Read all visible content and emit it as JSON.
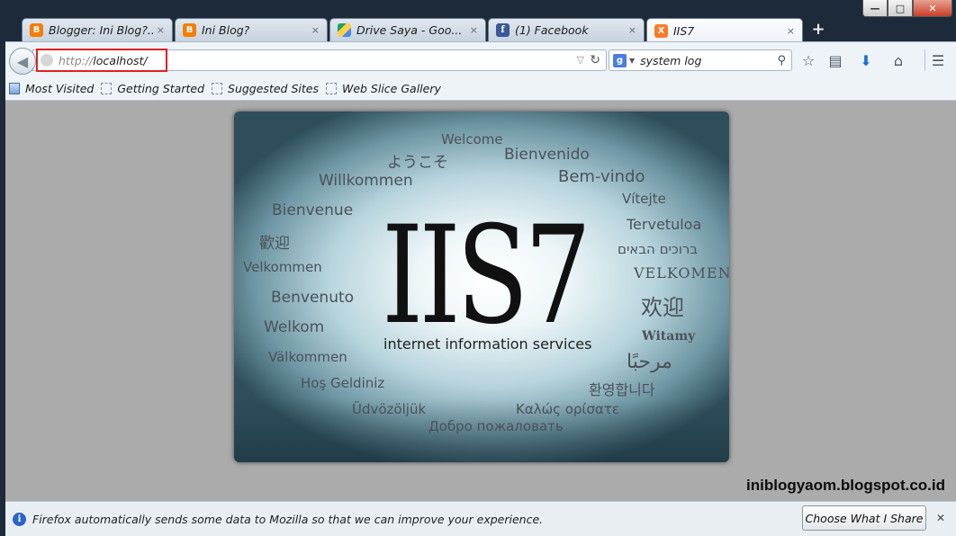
{
  "window_controls": {
    "minimize": "—",
    "maximize": "□",
    "close": "✕"
  },
  "tabs": [
    {
      "label": "Blogger: Ini Blog?...",
      "icon": "blogger-icon",
      "favicon_char": "B"
    },
    {
      "label": "Ini Blog?",
      "icon": "blogger-icon",
      "favicon_char": "B"
    },
    {
      "label": "Drive Saya - Goo...",
      "icon": "drive-icon",
      "favicon_char": ""
    },
    {
      "label": "(1) Facebook",
      "icon": "facebook-icon",
      "favicon_char": "f"
    },
    {
      "label": "IIS7",
      "icon": "xampp-icon",
      "favicon_char": "X",
      "active": true
    }
  ],
  "tab_close_glyph": "×",
  "new_tab_glyph": "+",
  "navbar": {
    "back_glyph": "◀",
    "url_scheme": "http://",
    "url_host": "localhost/",
    "dropmarker_glyph": "▽",
    "reload_glyph": "↻",
    "search_engine_char": "g",
    "search_drop_glyph": "▼",
    "search_value": "system log",
    "search_glyph": "⚲",
    "bookmark_star_glyph": "☆",
    "reading_list_glyph": "▤",
    "downloads_glyph": "⬇",
    "home_glyph": "⌂",
    "menu_glyph": "☰"
  },
  "bookmarks": [
    {
      "label": "Most Visited"
    },
    {
      "label": "Getting Started"
    },
    {
      "label": "Suggested Sites"
    },
    {
      "label": "Web Slice Gallery"
    }
  ],
  "page": {
    "logo": "IIS7",
    "subtitle": "internet information services",
    "greetings": [
      "Welcome",
      "ようこそ",
      "Bienvenido",
      "Willkommen",
      "Bem-vindo",
      "Vítejte",
      "Bienvenue",
      "Tervetuloa",
      "歡迎",
      "ברוכים הבאים",
      "Velkommen",
      "VELKOMEN",
      "Benvenuto",
      "欢迎",
      "Welkom",
      "Witamy",
      "Välkommen",
      "مرحبًا",
      "Hoş Geldiniz",
      "환영합니다",
      "Üdvözöljük",
      "Καλώς ορίσατε",
      "Добро пожаловать"
    ]
  },
  "watermark": "iniblogyaom.blogspot.co.id",
  "notification": {
    "info_glyph": "i",
    "text": "Firefox automatically sends some data to Mozilla so that we can improve your experience.",
    "button": "Choose What I Share",
    "close_glyph": "✕"
  },
  "colors": {
    "highlight_box": "#e02020",
    "frame": "#1c2a3a",
    "content_bg": "#ababab"
  }
}
